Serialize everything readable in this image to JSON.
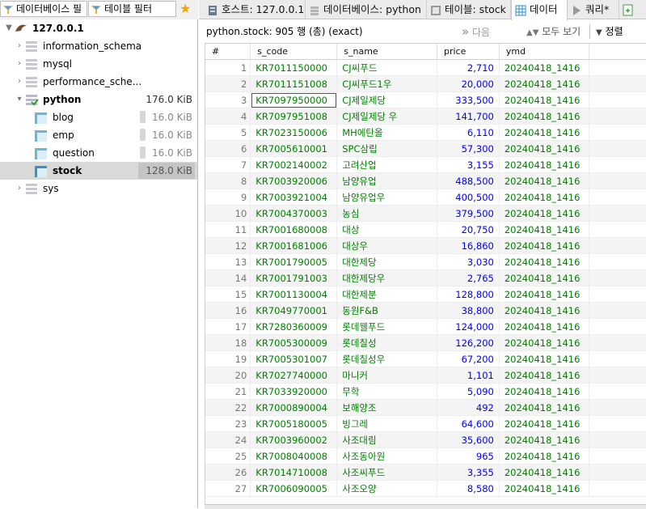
{
  "filters": {
    "db_filter_placeholder": "데이터베이스 필",
    "table_filter_placeholder": "테이블 필터"
  },
  "tabs": [
    {
      "label": "호스트: 127.0.0.1",
      "icon": "server-icon"
    },
    {
      "label": "데이터베이스: python",
      "icon": "database-icon"
    },
    {
      "label": "테이블: stock",
      "icon": "table-icon"
    },
    {
      "label": "데이터",
      "icon": "grid-icon",
      "active": true
    },
    {
      "label": "쿼리*",
      "icon": "play-icon"
    }
  ],
  "tree": {
    "host": "127.0.0.1",
    "databases": [
      {
        "name": "information_schema"
      },
      {
        "name": "mysql"
      },
      {
        "name": "performance_sche..."
      },
      {
        "name": "python",
        "size": "176.0 KiB",
        "expanded": true,
        "tables": [
          {
            "name": "blog",
            "size": "16.0 KiB"
          },
          {
            "name": "emp",
            "size": "16.0 KiB"
          },
          {
            "name": "question",
            "size": "16.0 KiB"
          },
          {
            "name": "stock",
            "size": "128.0 KiB",
            "selected": true
          }
        ]
      },
      {
        "name": "sys"
      }
    ]
  },
  "toolbar": {
    "title": "python.stock: 905 행 (총) (exact)",
    "next_label": "다음",
    "show_all_label": "모두 보기",
    "sort_label": "정렬"
  },
  "grid": {
    "columns": [
      "#",
      "s_code",
      "s_name",
      "price",
      "ymd"
    ],
    "rows": [
      [
        "1",
        "KR7011150000",
        "CJ씨푸드",
        "2,710",
        "20240418_1416"
      ],
      [
        "2",
        "KR7011151008",
        "CJ씨푸드1우",
        "20,000",
        "20240418_1416"
      ],
      [
        "3",
        "KR7097950000",
        "CJ제일제당",
        "333,500",
        "20240418_1416"
      ],
      [
        "4",
        "KR7097951008",
        "CJ제일제당 우",
        "141,700",
        "20240418_1416"
      ],
      [
        "5",
        "KR7023150006",
        "MH에탄올",
        "6,110",
        "20240418_1416"
      ],
      [
        "6",
        "KR7005610001",
        "SPC삼립",
        "57,300",
        "20240418_1416"
      ],
      [
        "7",
        "KR7002140002",
        "고려산업",
        "3,155",
        "20240418_1416"
      ],
      [
        "8",
        "KR7003920006",
        "남양유업",
        "488,500",
        "20240418_1416"
      ],
      [
        "9",
        "KR7003921004",
        "남양유업우",
        "400,500",
        "20240418_1416"
      ],
      [
        "10",
        "KR7004370003",
        "농심",
        "379,500",
        "20240418_1416"
      ],
      [
        "11",
        "KR7001680008",
        "대상",
        "20,750",
        "20240418_1416"
      ],
      [
        "12",
        "KR7001681006",
        "대상우",
        "16,860",
        "20240418_1416"
      ],
      [
        "13",
        "KR7001790005",
        "대한제당",
        "3,030",
        "20240418_1416"
      ],
      [
        "14",
        "KR7001791003",
        "대한제당우",
        "2,765",
        "20240418_1416"
      ],
      [
        "15",
        "KR7001130004",
        "대한제분",
        "128,800",
        "20240418_1416"
      ],
      [
        "16",
        "KR7049770001",
        "동원F&B",
        "38,800",
        "20240418_1416"
      ],
      [
        "17",
        "KR7280360009",
        "롯데웰푸드",
        "124,000",
        "20240418_1416"
      ],
      [
        "18",
        "KR7005300009",
        "롯데칠성",
        "126,200",
        "20240418_1416"
      ],
      [
        "19",
        "KR7005301007",
        "롯데칠성우",
        "67,200",
        "20240418_1416"
      ],
      [
        "20",
        "KR7027740000",
        "마니커",
        "1,101",
        "20240418_1416"
      ],
      [
        "21",
        "KR7033920000",
        "무학",
        "5,090",
        "20240418_1416"
      ],
      [
        "22",
        "KR7000890004",
        "보해양조",
        "492",
        "20240418_1416"
      ],
      [
        "23",
        "KR7005180005",
        "빙그레",
        "64,600",
        "20240418_1416"
      ],
      [
        "24",
        "KR7003960002",
        "사조대림",
        "35,600",
        "20240418_1416"
      ],
      [
        "25",
        "KR7008040008",
        "사조동아원",
        "965",
        "20240418_1416"
      ],
      [
        "26",
        "KR7014710008",
        "사조씨푸드",
        "3,355",
        "20240418_1416"
      ],
      [
        "27",
        "KR7006090005",
        "사조오양",
        "8,580",
        "20240418_1416"
      ]
    ]
  },
  "colors": {
    "string": "#008000",
    "number": "#0000ff",
    "accent": "#2e8bd8"
  }
}
